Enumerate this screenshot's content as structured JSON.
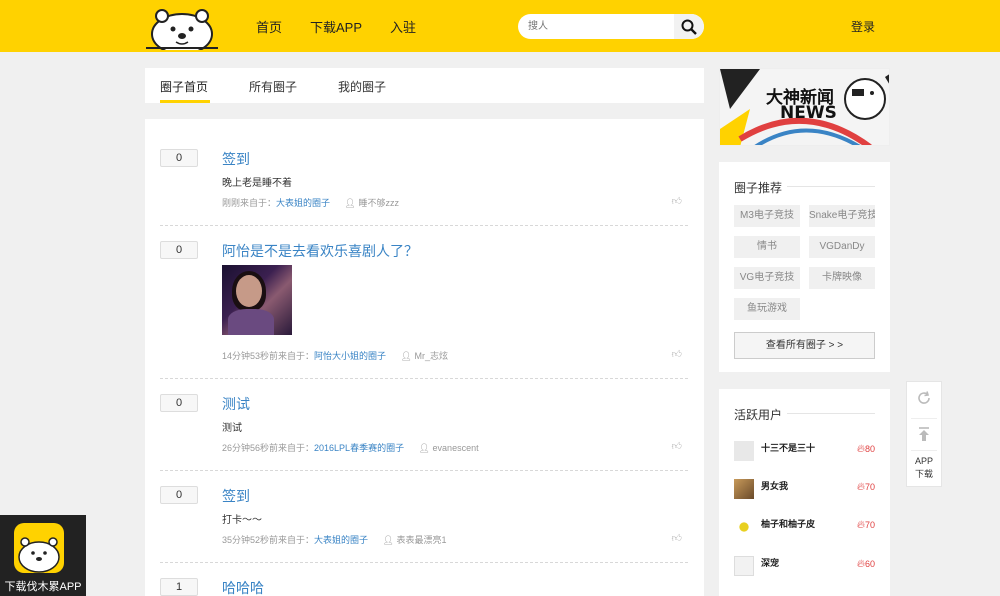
{
  "header": {
    "nav": [
      "首页",
      "下载APP",
      "入驻"
    ],
    "search_placeholder": "搜人",
    "login": "登录"
  },
  "tabs": [
    "圈子首页",
    "所有圈子",
    "我的圈子"
  ],
  "posts": [
    {
      "votes": "0",
      "title": "签到",
      "body": "晚上老是睡不着",
      "time": "刚刚来自于：",
      "circle": "大表姐的圈子",
      "user": "睡不够zzz"
    },
    {
      "votes": "0",
      "title": "阿怡是不是去看欢乐喜剧人了？",
      "time": "14分钟53秒前来自于：",
      "circle": "阿怡大小姐的圈子",
      "user": "Mr_志炫"
    },
    {
      "votes": "0",
      "title": "测试",
      "body": "测试",
      "time": "26分钟56秒前来自于：",
      "circle": "2016LPL春季赛的圈子",
      "user": "evanescent"
    },
    {
      "votes": "0",
      "title": "签到",
      "body": "打卡～～",
      "time": "35分钟52秒前来自于：",
      "circle": "大表姐的圈子",
      "user": "表表最漂亮1"
    },
    {
      "votes": "1",
      "title": "哈哈哈"
    }
  ],
  "banner": {
    "line1": "大神新闻",
    "line2": "NEWS"
  },
  "circles_card": {
    "title": "圈子推荐",
    "chips": [
      "M3电子竞技",
      "Snake电子竞技",
      "情书",
      "VGDanDy",
      "VG电子竞技",
      "卡牌映像",
      "鱼玩游戏"
    ],
    "all_button": "查看所有圈子 > >"
  },
  "users_card": {
    "title": "活跃用户",
    "users": [
      {
        "name": "十三不是三十",
        "score": "80"
      },
      {
        "name": "男女我",
        "score": "70"
      },
      {
        "name": "柚子和柚子皮",
        "score": "70"
      },
      {
        "name": "深宠",
        "score": "60"
      }
    ]
  },
  "tools": {
    "app_line1": "APP",
    "app_line2": "下载"
  },
  "download": {
    "label": "下载伐木累APP"
  },
  "colors": {
    "brand": "#ffd200",
    "link": "#3a84c5",
    "hot": "#e04040"
  }
}
